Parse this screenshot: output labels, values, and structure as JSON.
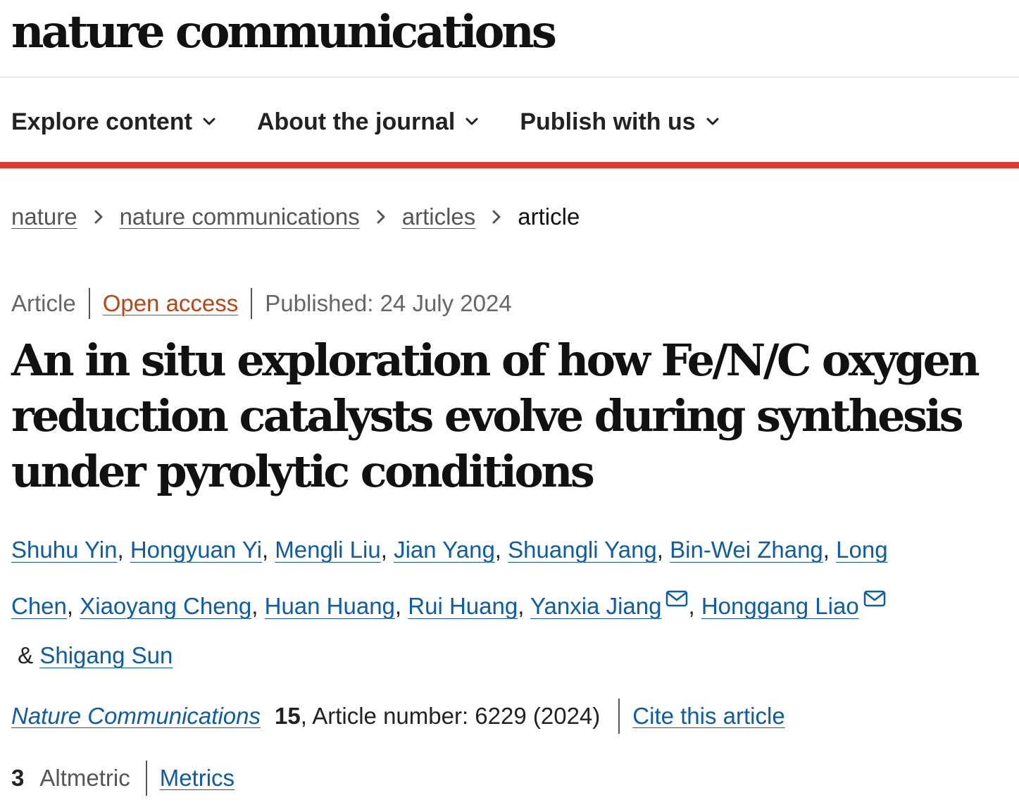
{
  "header": {
    "logo": "nature communications"
  },
  "nav": {
    "items": [
      {
        "label": "Explore content",
        "icon": "chevron-down-icon"
      },
      {
        "label": "About the journal",
        "icon": "chevron-down-icon"
      },
      {
        "label": "Publish with us",
        "icon": "chevron-down-icon"
      }
    ]
  },
  "colors": {
    "accent_bar": "#e2392e",
    "link": "#0c5da5",
    "open_access": "#b74616"
  },
  "breadcrumb": {
    "items": [
      "nature",
      "nature communications",
      "articles"
    ],
    "current": "article",
    "separator_icon": "chevron-right-icon"
  },
  "article": {
    "type": "Article",
    "access": "Open access",
    "published": "Published: 24 July 2024",
    "title": "An in situ exploration of how Fe/N/C oxygen reduction catalysts evolve during synthesis under pyrolytic conditions",
    "authors": [
      "Shuhu Yin",
      "Hongyuan Yi",
      "Mengli Liu",
      "Jian Yang",
      "Shuangli Yang",
      "Bin-Wei Zhang",
      "Long Chen",
      "Xiaoyang Cheng",
      "Huan Huang",
      "Rui Huang",
      "Yanxia Jiang",
      "Honggang Liao",
      "Shigang Sun"
    ],
    "author_separator": ", ",
    "author_last_separator": " & ",
    "corresponding_icon": "mail-icon"
  },
  "citation": {
    "journal": "Nature Communications",
    "volume": "15",
    "article_number": ", Article number: 6229 (2024)",
    "cite_label": "Cite this article"
  },
  "metrics": {
    "altmetric_score": "3",
    "altmetric_label": "Altmetric",
    "metrics_label": "Metrics"
  }
}
